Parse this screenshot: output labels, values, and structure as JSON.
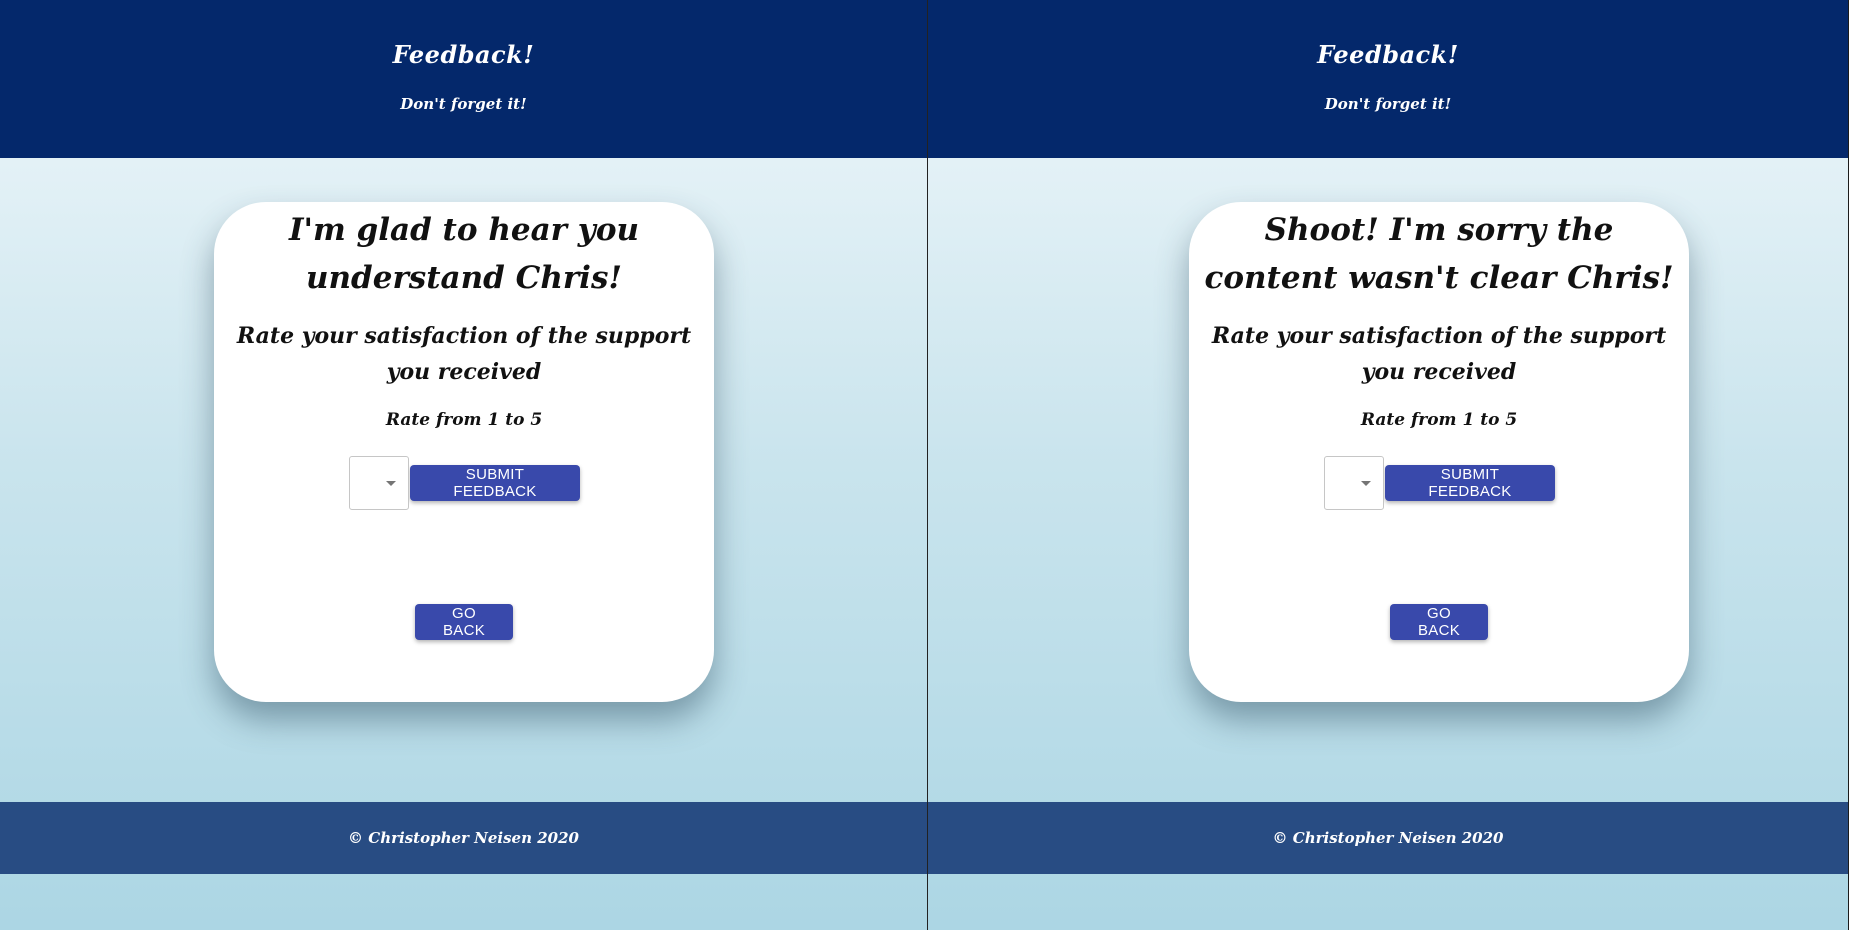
{
  "panels": [
    {
      "header": {
        "title": "Feedback!",
        "subtitle": "Don't forget it!"
      },
      "card": {
        "heading": "I'm glad to hear you understand Chris!",
        "rate_title": "Rate your satisfaction of the support you received",
        "rate_range": "Rate from 1 to 5",
        "select_value": "",
        "submit_label": "SUBMIT FEEDBACK",
        "back_label": "GO BACK"
      },
      "footer": "© Christopher Neisen 2020"
    },
    {
      "header": {
        "title": "Feedback!",
        "subtitle": "Don't forget it!"
      },
      "card": {
        "heading": "Shoot! I'm sorry the content wasn't clear Chris!",
        "rate_title": "Rate your satisfaction of the support you received",
        "rate_range": "Rate from 1 to 5",
        "select_value": "",
        "submit_label": "SUBMIT FEEDBACK",
        "back_label": "GO BACK"
      },
      "footer": "© Christopher Neisen 2020"
    }
  ],
  "colors": {
    "header_bg": "#04286b",
    "footer_bg": "#284c83",
    "button_bg": "#3949ab",
    "card_bg": "#ffffff"
  },
  "icons": {
    "select_caret": "caret-down-icon"
  }
}
